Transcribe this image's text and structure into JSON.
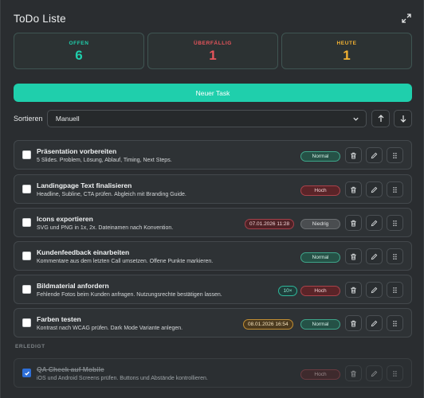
{
  "app": {
    "title": "ToDo Liste"
  },
  "stats": [
    {
      "label": "OFFEN",
      "value": "6",
      "color": "#1fcfac"
    },
    {
      "label": "ÜBERFÄLLIG",
      "value": "1",
      "color": "#e8555c"
    },
    {
      "label": "HEUTE",
      "value": "1",
      "color": "#f3b233"
    }
  ],
  "new_task_label": "Neuer Task",
  "sort": {
    "label": "Sortieren",
    "value": "Manuell"
  },
  "tasks": [
    {
      "title": "Präsentation vorbereiten",
      "desc": "5 Slides. Problem, Lösung, Ablauf, Timing, Next Steps.",
      "priority": "Normal"
    },
    {
      "title": "Landingpage Text finalisieren",
      "desc": "Headline, Subline, CTA prüfen. Abgleich mit Branding Guide.",
      "priority": "Hoch"
    },
    {
      "title": "Icons exportieren",
      "desc": "SVG und PNG in 1x, 2x. Dateinamen nach Konvention.",
      "priority": "Niedrig",
      "due": "07.01.2026 11:28"
    },
    {
      "title": "Kundenfeedback einarbeiten",
      "desc": "Kommentare aus dem letzten Call umsetzen. Offene Punkte markieren.",
      "priority": "Normal"
    },
    {
      "title": "Bildmaterial anfordern",
      "desc": "Fehlende Fotos beim Kunden anfragen. Nutzungsrechte bestätigen lassen.",
      "priority": "Hoch",
      "count": "10×"
    },
    {
      "title": "Farben testen",
      "desc": "Kontrast nach WCAG prüfen. Dark Mode Variante anlegen.",
      "priority": "Normal",
      "due": "08.01.2026 16:54"
    }
  ],
  "done_section_label": "ERLEDIGT",
  "done_tasks": [
    {
      "title": "QA Check auf Mobile",
      "desc": "iOS und Android Screens prüfen. Buttons und Abstände kontrollieren.",
      "priority": "Hoch"
    }
  ]
}
